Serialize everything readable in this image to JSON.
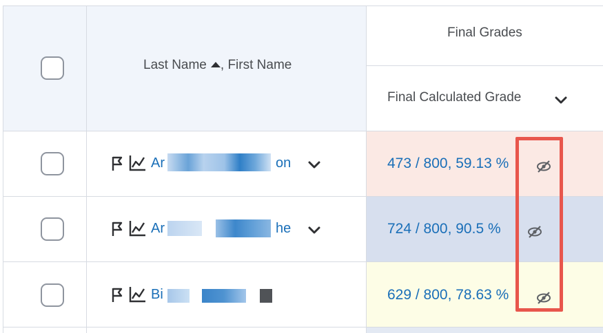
{
  "header": {
    "name_column": {
      "last_name": "Last Name",
      "separator": ", ",
      "first_name": "First Name"
    },
    "group_title": "Final Grades",
    "grade_column": "Final Calculated Grade"
  },
  "rows": [
    {
      "name_prefix": "A",
      "name_visible_start": "Ar",
      "name_visible_end": "on",
      "grade": "473 / 800, 59.13 %",
      "grade_bg": "#fbe9e4"
    },
    {
      "name_prefix": "A",
      "name_visible_start": "Ar",
      "name_visible_end": "he",
      "grade": "724 / 800, 90.5 %",
      "grade_bg": "#d7dfee"
    },
    {
      "name_prefix": "B",
      "name_visible_start": "Bi",
      "name_visible_end": "",
      "grade": "629 / 800, 78.63 %",
      "grade_bg": "#fdfde6"
    }
  ],
  "icons": {
    "flag": "flag-icon",
    "stats": "line-chart-icon",
    "hidden": "eye-slash-icon",
    "expand": "chevron-down-icon",
    "sort": "sort-ascending-icon"
  },
  "colors": {
    "link": "#1a6fb8",
    "highlight": "#e8564c",
    "header_bg": "#f1f5fb"
  }
}
